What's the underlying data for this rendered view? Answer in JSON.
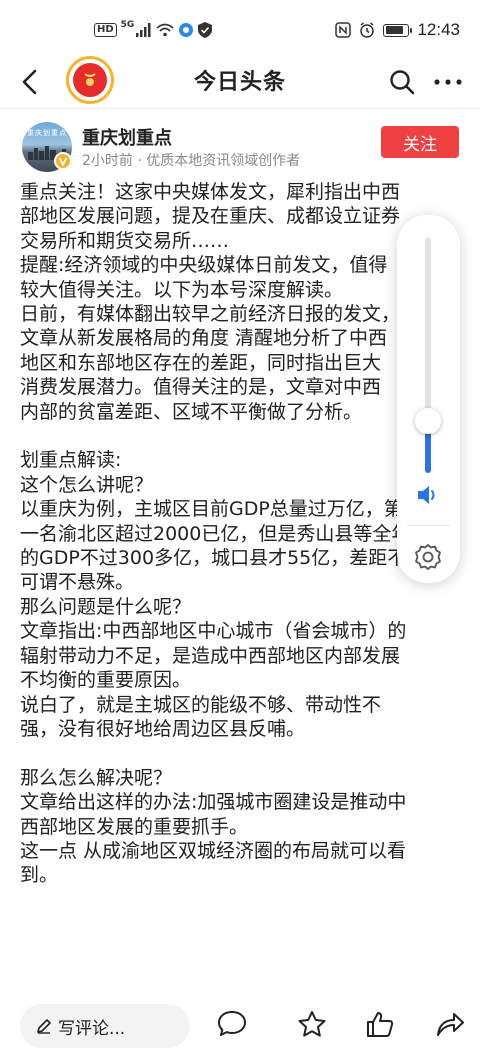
{
  "status_bar": {
    "network_badge": "HD",
    "network_type": "5G",
    "time": "12:43",
    "battery_level": 0.8
  },
  "header": {
    "title": "今日头条",
    "back_icon": "chevron-left-icon",
    "search_icon": "search-icon",
    "more_icon": "more-horizontal-icon"
  },
  "author": {
    "name": "重庆划重点",
    "meta": "2小时前 · 优质本地资讯领域创作者",
    "avatar_text": "重庆划重点",
    "verified": true,
    "follow_label": "关注"
  },
  "article": {
    "lines": [
      "重点关注！这家中央媒体发文，犀利指出中西",
      "部地区发展问题，提及在重庆、成都设立证券",
      "交易所和期货交易所……",
      "提醒:经济领域的中央级媒体日前发文，值得",
      "较大值得关注。以下为本号深度解读。",
      "日前，有媒体翻出较早之前经济日报的发文，",
      "文章从新发展格局的角度 清醒地分析了中西",
      "地区和东部地区存在的差距，同时指出巨大",
      "消费发展潜力。值得关注的是，文章对中西",
      "内部的贫富差距、区域不平衡做了分析。",
      "",
      "划重点解读:",
      "这个怎么讲呢？",
      "以重庆为例，主城区目前GDP总量过万亿，第",
      "一名渝北区超过2000已亿，但是秀山县等全年",
      "的GDP不过300多亿，城口县才55亿，差距不",
      "可谓不悬殊。",
      "那么问题是什么呢？",
      "文章指出:中西部地区中心城市（省会城市）的",
      "辐射带动力不足，是造成中西部地区内部发展",
      "不均衡的重要原因。",
      "说白了，就是主城区的能级不够、带动性不",
      "强，没有很好地给周边区县反哺。",
      "",
      "那么怎么解决呢？",
      "文章给出这样的办法:加强城市圈建设是推动中",
      "西部地区发展的重要抓手。",
      "这一点 从成渝地区双城经济圈的布局就可以看",
      "到。"
    ]
  },
  "volume": {
    "level": 0.22,
    "speaker_icon": "speaker-icon",
    "settings_icon": "settings-gear-icon",
    "accent_color": "#2a73e8"
  },
  "bottom_bar": {
    "comment_placeholder": "写评论...",
    "icons": [
      "pencil-icon",
      "comment-icon",
      "star-icon",
      "like-icon",
      "share-icon"
    ]
  },
  "colors": {
    "follow_button": "#f04142",
    "logo_ring": "#f3b52b",
    "logo_fill": "#e62b2b"
  }
}
